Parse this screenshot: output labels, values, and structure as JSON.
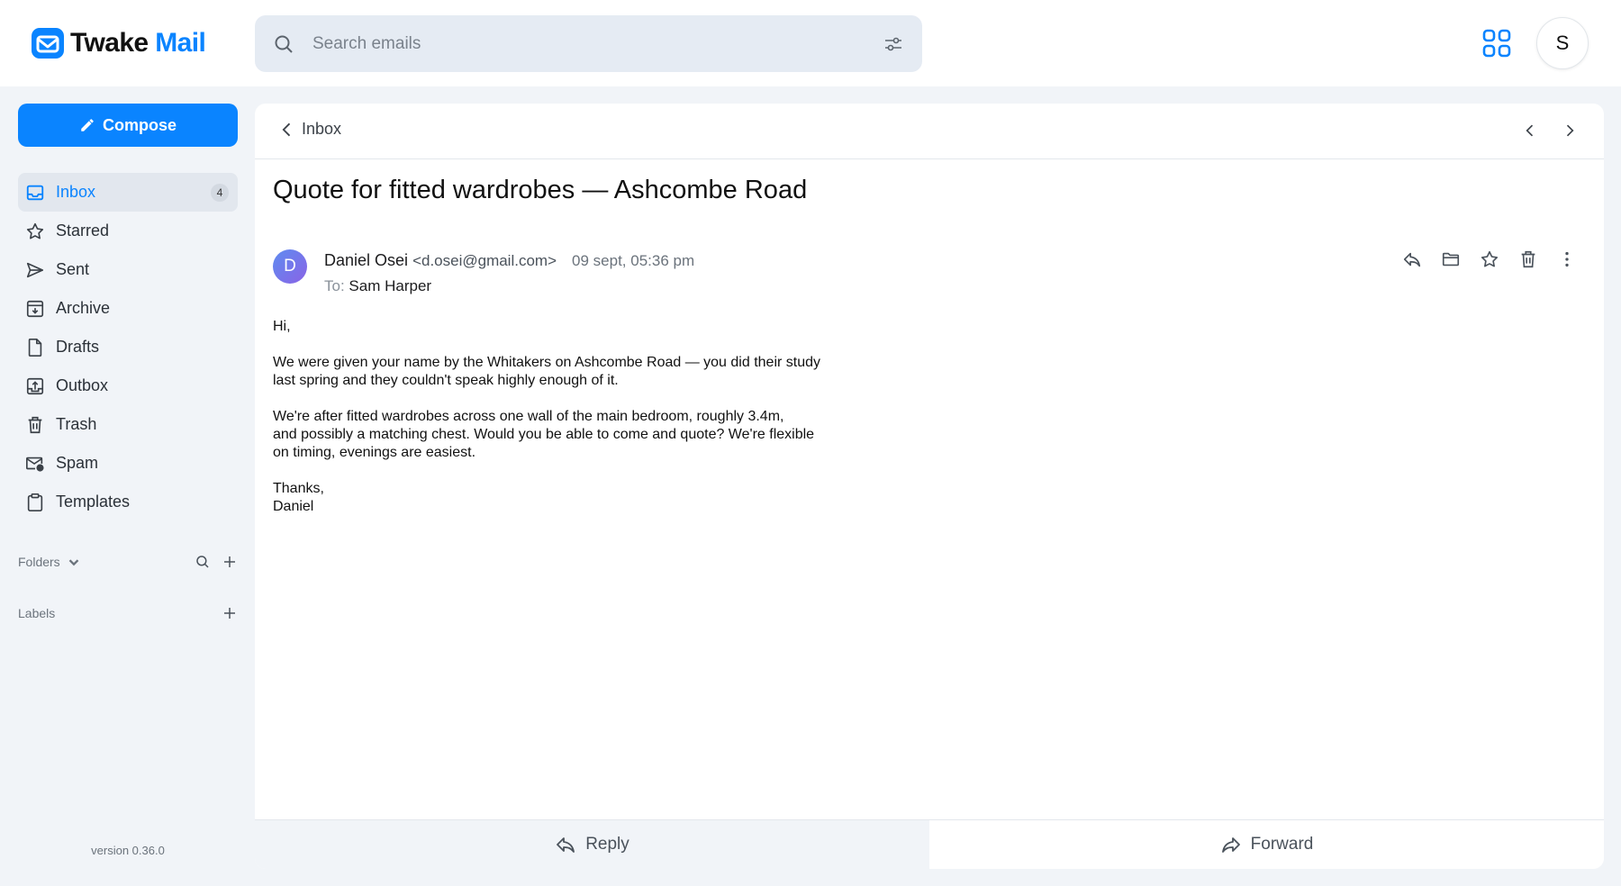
{
  "app": {
    "name_part1": "Twake",
    "name_part2": "Mail",
    "accent": "#0a84ff"
  },
  "search": {
    "placeholder": "Search emails"
  },
  "user": {
    "initial": "S"
  },
  "sidebar": {
    "compose_label": "Compose",
    "items": [
      {
        "label": "Inbox",
        "icon": "inbox-icon",
        "badge": "4",
        "active": true
      },
      {
        "label": "Starred",
        "icon": "star-icon"
      },
      {
        "label": "Sent",
        "icon": "send-icon"
      },
      {
        "label": "Archive",
        "icon": "archive-icon"
      },
      {
        "label": "Drafts",
        "icon": "draft-icon"
      },
      {
        "label": "Outbox",
        "icon": "outbox-icon"
      },
      {
        "label": "Trash",
        "icon": "trash-icon"
      },
      {
        "label": "Spam",
        "icon": "spam-icon"
      },
      {
        "label": "Templates",
        "icon": "template-icon"
      }
    ],
    "folders_label": "Folders",
    "labels_label": "Labels",
    "version": "version 0.36.0"
  },
  "message": {
    "back_label": "Inbox",
    "subject": "Quote for fitted wardrobes — Ashcombe Road",
    "sender_initial": "D",
    "sender_name": "Daniel Osei",
    "sender_email": "<d.osei@gmail.com>",
    "date": "09 sept, 05:36 pm",
    "to_label": "To:",
    "to_name": "Sam Harper",
    "body": [
      "Hi,",
      "We were given your name by the Whitakers on Ashcombe Road — you did their study\nlast spring and they couldn't speak highly enough of it.",
      "We're after fitted wardrobes across one wall of the main bedroom, roughly 3.4m,\nand possibly a matching chest. Would you be able to come and quote? We're flexible\non timing, evenings are easiest.",
      "Thanks,\nDaniel"
    ]
  },
  "footer": {
    "reply_label": "Reply",
    "forward_label": "Forward"
  }
}
